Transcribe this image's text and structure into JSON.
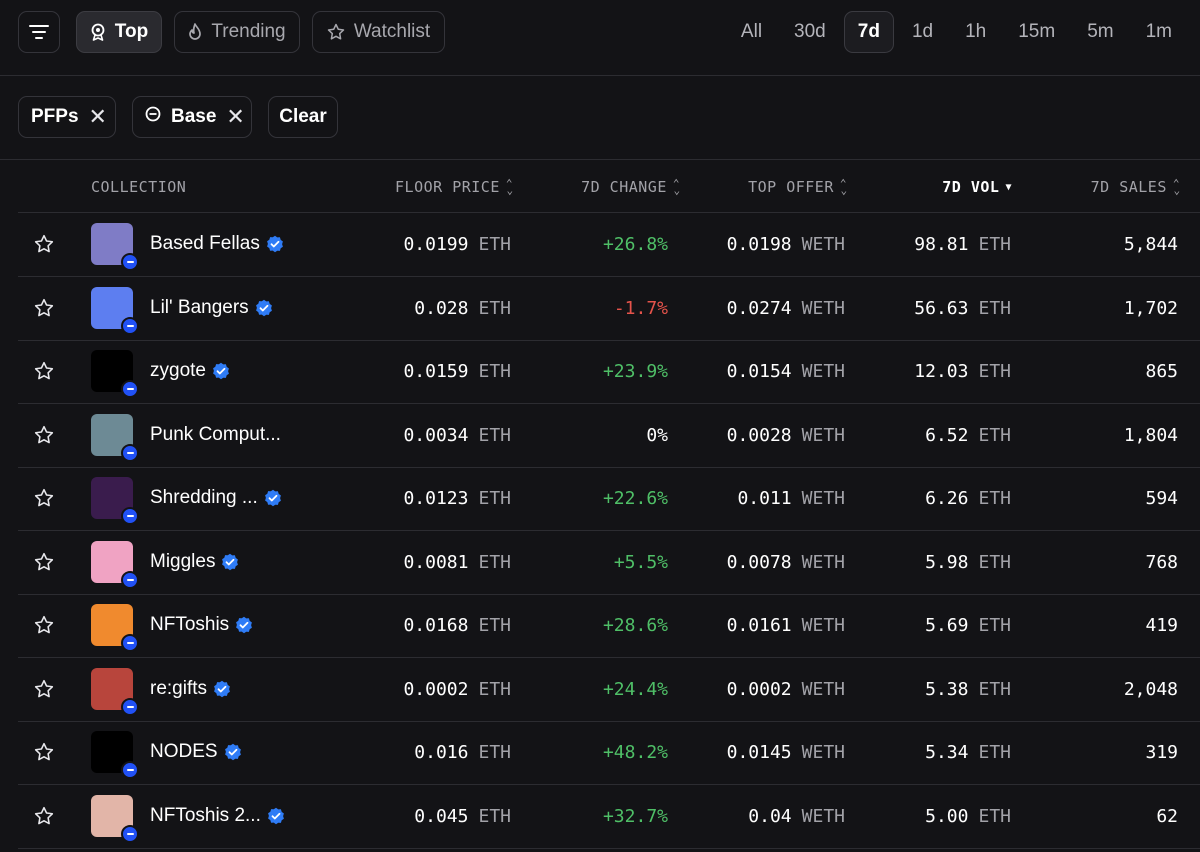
{
  "toolbar": {
    "tabs": [
      {
        "label": "Top",
        "icon": "trophy-icon",
        "active": true
      },
      {
        "label": "Trending",
        "icon": "flame-icon",
        "active": false
      },
      {
        "label": "Watchlist",
        "icon": "star-icon",
        "active": false
      }
    ],
    "timeframes": [
      "All",
      "30d",
      "7d",
      "1d",
      "1h",
      "15m",
      "5m",
      "1m"
    ],
    "active_timeframe": "7d"
  },
  "filters": {
    "chips": [
      {
        "label": "PFPs",
        "icon": ""
      },
      {
        "label": "Base",
        "icon": "base-chain-icon"
      }
    ],
    "clear_label": "Clear"
  },
  "table": {
    "headers": {
      "collection": "COLLECTION",
      "floor": "FLOOR PRICE",
      "change": "7D CHANGE",
      "offer": "TOP OFFER",
      "vol": "7D VOL",
      "sales": "7D SALES"
    },
    "sorted_column": "vol",
    "rows": [
      {
        "name": "Based Fellas",
        "verified": true,
        "floor": "0.0199",
        "floor_unit": "ETH",
        "change": "+26.8%",
        "offer": "0.0198",
        "offer_unit": "WETH",
        "vol": "98.81",
        "vol_unit": "ETH",
        "sales": "5,844"
      },
      {
        "name": "Lil' Bangers",
        "verified": true,
        "floor": "0.028",
        "floor_unit": "ETH",
        "change": "-1.7%",
        "offer": "0.0274",
        "offer_unit": "WETH",
        "vol": "56.63",
        "vol_unit": "ETH",
        "sales": "1,702"
      },
      {
        "name": "zygote",
        "verified": true,
        "floor": "0.0159",
        "floor_unit": "ETH",
        "change": "+23.9%",
        "offer": "0.0154",
        "offer_unit": "WETH",
        "vol": "12.03",
        "vol_unit": "ETH",
        "sales": "865"
      },
      {
        "name": "Punk Comput...",
        "verified": false,
        "floor": "0.0034",
        "floor_unit": "ETH",
        "change": "0%",
        "offer": "0.0028",
        "offer_unit": "WETH",
        "vol": "6.52",
        "vol_unit": "ETH",
        "sales": "1,804"
      },
      {
        "name": "Shredding ...",
        "verified": true,
        "floor": "0.0123",
        "floor_unit": "ETH",
        "change": "+22.6%",
        "offer": "0.011",
        "offer_unit": "WETH",
        "vol": "6.26",
        "vol_unit": "ETH",
        "sales": "594"
      },
      {
        "name": "Miggles",
        "verified": true,
        "floor": "0.0081",
        "floor_unit": "ETH",
        "change": "+5.5%",
        "offer": "0.0078",
        "offer_unit": "WETH",
        "vol": "5.98",
        "vol_unit": "ETH",
        "sales": "768"
      },
      {
        "name": "NFToshis",
        "verified": true,
        "floor": "0.0168",
        "floor_unit": "ETH",
        "change": "+28.6%",
        "offer": "0.0161",
        "offer_unit": "WETH",
        "vol": "5.69",
        "vol_unit": "ETH",
        "sales": "419"
      },
      {
        "name": "re:gifts",
        "verified": true,
        "floor": "0.0002",
        "floor_unit": "ETH",
        "change": "+24.4%",
        "offer": "0.0002",
        "offer_unit": "WETH",
        "vol": "5.38",
        "vol_unit": "ETH",
        "sales": "2,048"
      },
      {
        "name": "NODES",
        "verified": true,
        "floor": "0.016",
        "floor_unit": "ETH",
        "change": "+48.2%",
        "offer": "0.0145",
        "offer_unit": "WETH",
        "vol": "5.34",
        "vol_unit": "ETH",
        "sales": "319"
      },
      {
        "name": "NFToshis 2...",
        "verified": true,
        "floor": "0.045",
        "floor_unit": "ETH",
        "change": "+32.7%",
        "offer": "0.04",
        "offer_unit": "WETH",
        "vol": "5.00",
        "vol_unit": "ETH",
        "sales": "62"
      }
    ],
    "thumb_colors": [
      "#7f7cc6",
      "#5d7ef0",
      "#000000",
      "#6d8a95",
      "#3a1c4d",
      "#f0a3c3",
      "#f08a2e",
      "#b8453c",
      "#000000",
      "#e2b5a8"
    ]
  },
  "colors": {
    "positive": "#4fbf67",
    "negative": "#e5534b",
    "base_chain": "#2151f5",
    "verified": "#2f7cf6"
  }
}
